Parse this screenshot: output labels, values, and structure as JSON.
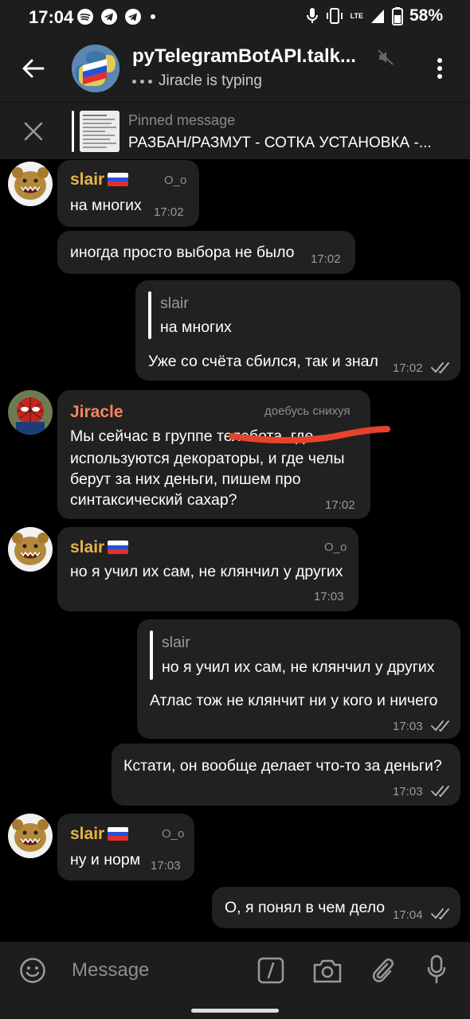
{
  "status_bar": {
    "time": "17:04",
    "battery": "58%",
    "network": "LTE"
  },
  "header": {
    "title": "pyTelegramBotAPI.talk...",
    "typing_text": "Jiracle is typing"
  },
  "pinned": {
    "label": "Pinned message",
    "text": "РАЗБАН/РАЗМУТ - СОТКА УСТАНОВКА -..."
  },
  "messages": [
    {
      "sender": "slair",
      "badge": "O_o",
      "text": "на многих",
      "time": "17:02"
    },
    {
      "text": "иногда просто выбора не было",
      "time": "17:02"
    },
    {
      "quote_name": "slair",
      "quote_text": "на многих",
      "text": "Уже со счёта сбился, так и знал",
      "time": "17:02"
    },
    {
      "sender": "Jiracle",
      "badge": "доебусь снихуя",
      "lines": [
        "Мы сейчас в  группе телебота, где",
        "используются декораторы, и где челы",
        "берут за них деньги,  пишем про",
        "синтаксический сахар?"
      ],
      "time": "17:02"
    },
    {
      "sender": "slair",
      "badge": "O_o",
      "text": "но я учил их сам, не клянчил у других",
      "time": "17:03"
    },
    {
      "quote_name": "slair",
      "quote_text": "но я учил их сам, не клянчил у других",
      "text": "Атлас тож не клянчит ни у кого и ничего",
      "time": "17:03"
    },
    {
      "text": "Кстати, он вообще делает что-то за деньги?",
      "time": "17:03"
    },
    {
      "sender": "slair",
      "badge": "O_o",
      "text": "ну и норм",
      "time": "17:03"
    },
    {
      "text": "О, я понял в чем дело",
      "time": "17:04"
    }
  ],
  "input": {
    "placeholder": "Message"
  },
  "colors": {
    "slair_name": "#e6b34a",
    "jiracle_name": "#f4845f",
    "bubble": "#212121",
    "bar": "#1d1d1d"
  }
}
